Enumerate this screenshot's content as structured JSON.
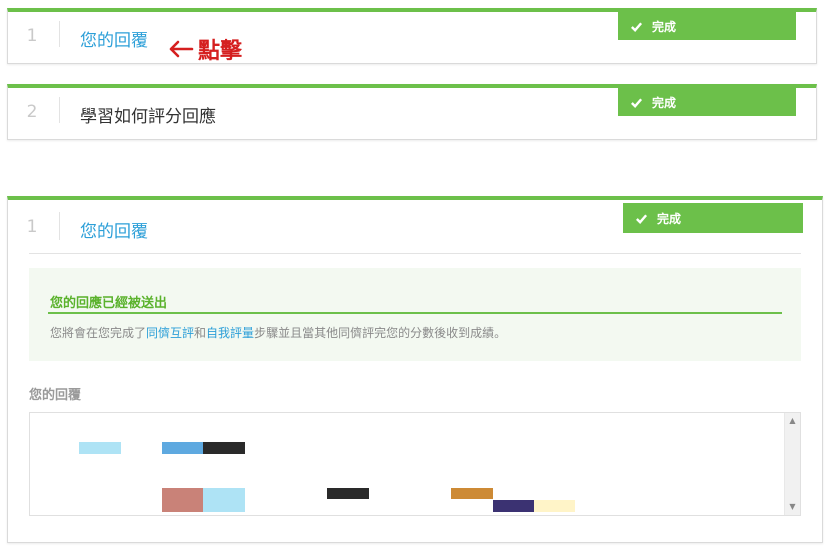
{
  "cards": [
    {
      "step": "1",
      "title": "您的回覆",
      "badge": "完成"
    },
    {
      "step": "2",
      "title": "學習如何評分回應",
      "badge": "完成"
    },
    {
      "step": "1",
      "title": "您的回覆",
      "badge": "完成"
    }
  ],
  "annotation": {
    "text": "點擊",
    "color": "#d51f1f"
  },
  "notice": {
    "title": "您的回應已經被送出",
    "text_before": "您將會在您完成了",
    "link1": "同儕互評",
    "text_mid": "和",
    "link2": "自我評量",
    "text_after": "步驟並且當其他同儕評完您的分數後收到成績。"
  },
  "response": {
    "label": "您的回覆",
    "redacted_blocks": [
      {
        "color": "#aee3f5"
      },
      {
        "color": "#5ea9e0"
      },
      {
        "color": "#2a2a2a"
      },
      {
        "color": "#c98278"
      },
      {
        "color": "#aee3f5"
      },
      {
        "color": "#2a2a2a"
      },
      {
        "color": "#cd8a35"
      },
      {
        "color": "#3b3272"
      },
      {
        "color": "#fff4c8"
      }
    ]
  },
  "icons": {
    "badge": "check-icon",
    "annotation": "arrow-left-icon"
  },
  "colors": {
    "accent": "#6cc04a",
    "link": "#2c9fd8"
  }
}
